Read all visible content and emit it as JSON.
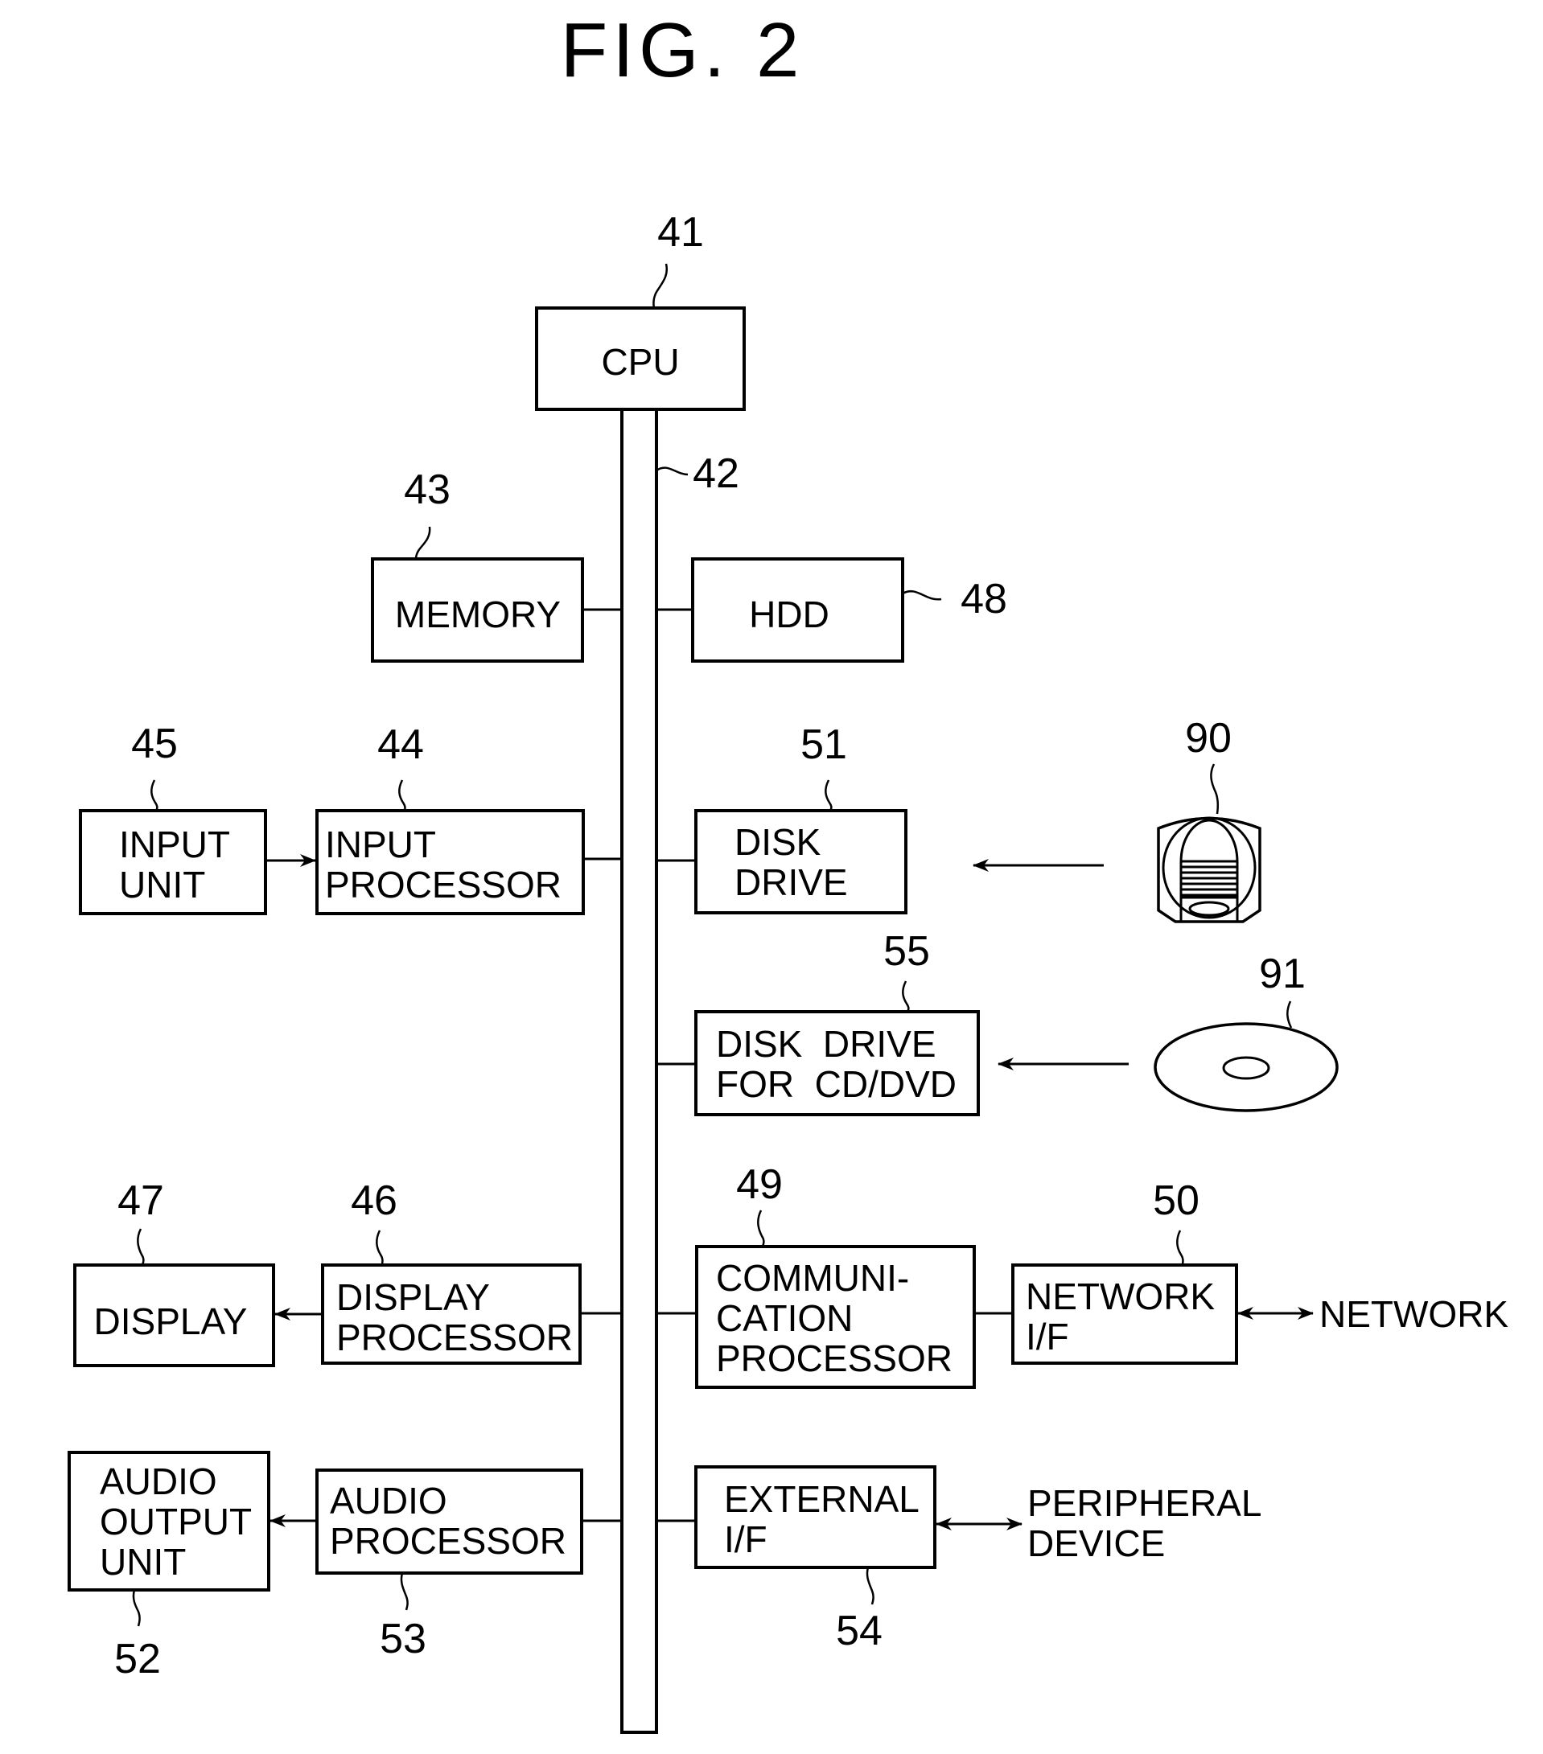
{
  "figure": {
    "title": "FIG. 2",
    "colors": {
      "ink": "#000000",
      "paper": "#ffffff"
    }
  },
  "blocks": {
    "cpu": {
      "ref": "41",
      "lines": [
        "CPU"
      ]
    },
    "bus": {
      "ref": "42"
    },
    "memory": {
      "ref": "43",
      "lines": [
        "MEMORY"
      ]
    },
    "hdd": {
      "ref": "48",
      "lines": [
        "HDD"
      ]
    },
    "input_unit": {
      "ref": "45",
      "lines": [
        "INPUT",
        "UNIT"
      ]
    },
    "input_processor": {
      "ref": "44",
      "lines": [
        "INPUT",
        "PROCESSOR"
      ]
    },
    "disk_drive": {
      "ref": "51",
      "lines": [
        "DISK",
        "DRIVE"
      ]
    },
    "cartridge": {
      "ref": "90"
    },
    "cd_dvd_drive": {
      "ref": "55",
      "lines": [
        "DISK  DRIVE",
        "FOR  CD/DVD"
      ]
    },
    "disc": {
      "ref": "91"
    },
    "display": {
      "ref": "47",
      "lines": [
        "DISPLAY"
      ]
    },
    "display_processor": {
      "ref": "46",
      "lines": [
        "DISPLAY",
        "PROCESSOR"
      ]
    },
    "comm_processor": {
      "ref": "49",
      "lines": [
        "COMMUNI-",
        "CATION",
        "PROCESSOR"
      ]
    },
    "network_if": {
      "ref": "50",
      "lines": [
        "NETWORK",
        "I/F"
      ]
    },
    "audio_output": {
      "ref": "52",
      "lines": [
        "AUDIO",
        "OUTPUT",
        "UNIT"
      ]
    },
    "audio_processor": {
      "ref": "53",
      "lines": [
        "AUDIO",
        "PROCESSOR"
      ]
    },
    "external_if": {
      "ref": "54",
      "lines": [
        "EXTERNAL",
        "I/F"
      ]
    }
  },
  "external": {
    "network": {
      "lines": [
        "NETWORK"
      ]
    },
    "peripheral": {
      "lines": [
        "PERIPHERAL",
        "DEVICE"
      ]
    }
  }
}
